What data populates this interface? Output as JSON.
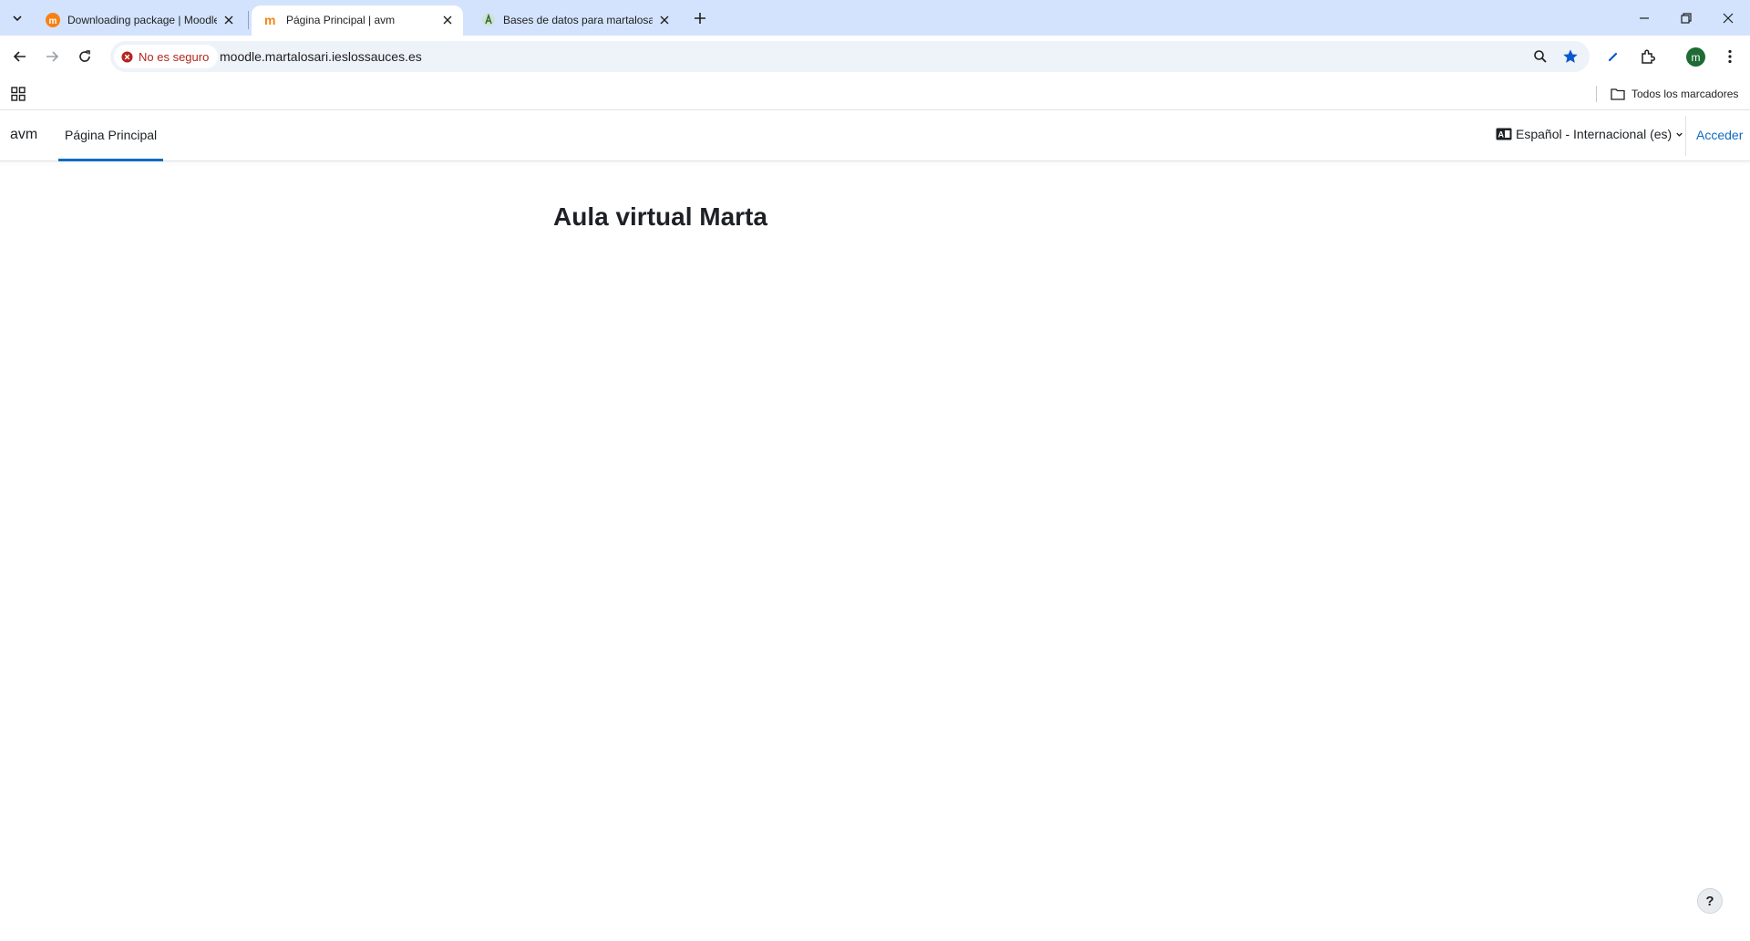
{
  "browser": {
    "tabs": [
      {
        "title": "Downloading package | Moodle",
        "favicon": "moodle-orange-icon",
        "active": false
      },
      {
        "title": "Página Principal | avm",
        "favicon": "moodle-icon",
        "active": true
      },
      {
        "title": "Bases de datos para martalosari",
        "favicon": "hosting-icon",
        "active": false
      }
    ],
    "security_label": "No es seguro",
    "url": "moodle.martalosari.ieslossauces.es",
    "profile_initial": "m",
    "bookmarks_folder_label": "Todos los marcadores",
    "colors": {
      "tabstrip": "#d3e3fd",
      "omnibox": "#eef2f9",
      "insecure": "#b3261e",
      "star": "#0b57d0"
    }
  },
  "moodle": {
    "site_name": "avm",
    "primary_nav": [
      "Página Principal"
    ],
    "language": "Español - Internacional (es)",
    "login_label": "Acceder",
    "heading": "Aula virtual Marta",
    "help_label": "?",
    "colors": {
      "link": "#0f6cbf",
      "text": "#1d2125"
    }
  }
}
